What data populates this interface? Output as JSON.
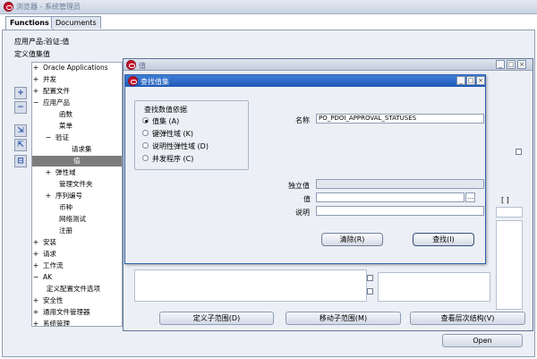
{
  "window": {
    "title": "浏览器 - 系统管理员"
  },
  "tabs": [
    {
      "label": "Functions"
    },
    {
      "label": "Documents"
    }
  ],
  "header": {
    "context": "应用产品:验证:值",
    "section": "定义值集值"
  },
  "tree": {
    "items": [
      {
        "expander": "+",
        "label": "Oracle Applications"
      },
      {
        "expander": "+",
        "label": "并发"
      },
      {
        "expander": "+",
        "label": "配置文件"
      },
      {
        "expander": "−",
        "label": "应用产品"
      },
      {
        "expander": "",
        "label": "函数"
      },
      {
        "expander": "",
        "label": "菜单"
      },
      {
        "expander": "−",
        "label": "验证"
      },
      {
        "expander": "",
        "label": "请求集"
      },
      {
        "expander": "",
        "label": "值",
        "selected": true
      },
      {
        "expander": "+",
        "label": "弹性域"
      },
      {
        "expander": "",
        "label": "管理文件夹"
      },
      {
        "expander": "+",
        "label": "序列编号"
      },
      {
        "expander": "",
        "label": "币种"
      },
      {
        "expander": "",
        "label": "网络测试"
      },
      {
        "expander": "",
        "label": "注册"
      },
      {
        "expander": "+",
        "label": "安装"
      },
      {
        "expander": "+",
        "label": "请求"
      },
      {
        "expander": "+",
        "label": "工作流"
      },
      {
        "expander": "−",
        "label": "AK"
      },
      {
        "expander": "",
        "label": "定义配置文件选项"
      },
      {
        "expander": "+",
        "label": "安全性"
      },
      {
        "expander": "+",
        "label": "通用文件管理器"
      },
      {
        "expander": "+",
        "label": "系统管理"
      }
    ]
  },
  "side_buttons": [
    "+",
    "−",
    "⇲",
    "⇱",
    "⊟"
  ],
  "values_window": {
    "title": "值",
    "bottom_buttons": [
      {
        "label": "定义子范围(D)"
      },
      {
        "label": "移动子范围(M)"
      },
      {
        "label": "查看层次结构(V)"
      }
    ]
  },
  "open_button": {
    "label": "Open"
  },
  "find_dialog": {
    "title": "查找值集",
    "group_title": "查找数值依据",
    "options": [
      {
        "label": "值集 (A)",
        "selected": true
      },
      {
        "label": "键弹性域 (K)",
        "selected": false
      },
      {
        "label": "说明性弹性域 (D)",
        "selected": false
      },
      {
        "label": "并发程序 (C)",
        "selected": false
      }
    ],
    "name_label": "名称",
    "name_value": "PO_PDOI_APPROVAL_STATUSES",
    "independent_label": "独立值",
    "value_label": "值",
    "value_lov": "...",
    "description_label": "说明",
    "clear_button": "清除(R)",
    "find_button": "查找(I)"
  },
  "misc": {
    "bracket_text": "[  ]"
  }
}
